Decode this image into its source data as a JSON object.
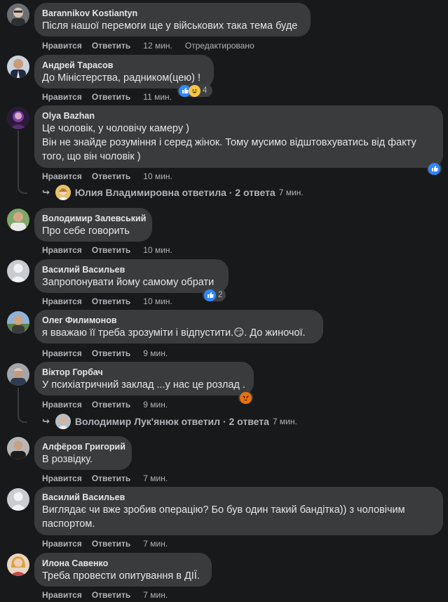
{
  "actions": {
    "like": "Нравится",
    "reply": "Ответить",
    "edited": "Отредактировано"
  },
  "comments": [
    {
      "author": "Barannikov Kostiantyn",
      "lines": [
        "Після нашої перемоги ще у військових така тема буде"
      ],
      "time": "12 мин."
    },
    {
      "author": "Андрей Тарасов",
      "lines": [
        "До Міністерства, радником(цею) !"
      ],
      "time": "11 мин.",
      "reaction_count": "4"
    },
    {
      "author": "Olya Bazhan",
      "lines": [
        "Це чоловік, у чоловічу камеру )",
        "Він не знайде розуміння і серед жінок. Тому мусимо відштовхуватись від факту",
        "того, що він чоловік )"
      ],
      "time": "10 мин.",
      "replies": {
        "text": "Юлия Владимировна ответила · 2 ответа",
        "time": "7 мин."
      }
    },
    {
      "author": "Володимир Залевський",
      "lines": [
        "Про себе говорить"
      ],
      "time": "10 мин."
    },
    {
      "author": "Василий Васильев",
      "lines": [
        "Запропонувати йому самому обрати"
      ],
      "time": "10 мин.",
      "reaction_count": "2"
    },
    {
      "author": "Олег Филимонов",
      "lines": [
        "я вважаю її треба зрозуміти і відпустити.😏. До жиночої."
      ],
      "time": "9 мин."
    },
    {
      "author": "Віктор Горбач",
      "lines": [
        "У психіатричний заклад ...у нас це розлад ."
      ],
      "time": "9 мин.",
      "replies": {
        "text": "Володимир Лук'янюк ответил · 2 ответа",
        "time": "7 мин."
      }
    },
    {
      "author": "Алфёров Григорий",
      "lines": [
        "В розвідку."
      ],
      "time": "7 мин."
    },
    {
      "author": "Василий Васильев",
      "lines": [
        "Виглядає чи вже зробив операцію? Бо був один такий бандітка)) з чоловічим",
        "паспортом."
      ],
      "time": "7 мин."
    },
    {
      "author": "Илона Савенко",
      "lines": [
        "Треба провести опитування в ДІЇ."
      ],
      "time": "7 мин."
    }
  ]
}
